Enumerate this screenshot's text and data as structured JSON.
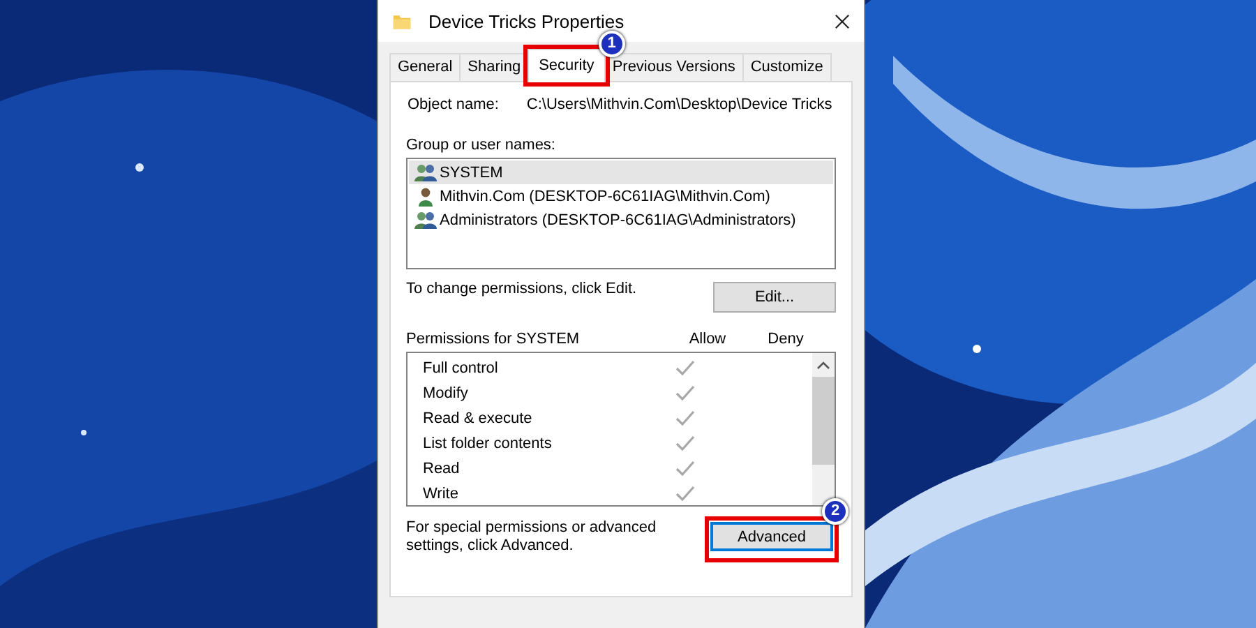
{
  "window": {
    "title": "Device Tricks Properties"
  },
  "tabs": [
    {
      "label": "General",
      "selected": false
    },
    {
      "label": "Sharing",
      "selected": false
    },
    {
      "label": "Security",
      "selected": true,
      "marker": "1"
    },
    {
      "label": "Previous Versions",
      "selected": false
    },
    {
      "label": "Customize",
      "selected": false
    }
  ],
  "object_name": {
    "label": "Object name:",
    "value": "C:\\Users\\Mithvin.Com\\Desktop\\Device Tricks"
  },
  "groups": {
    "label": "Group or user names:",
    "items": [
      {
        "name": "SYSTEM",
        "kind": "group",
        "selected": true
      },
      {
        "name": "Mithvin.Com (DESKTOP-6C61IAG\\Mithvin.Com)",
        "kind": "user",
        "selected": false
      },
      {
        "name": "Administrators (DESKTOP-6C61IAG\\Administrators)",
        "kind": "group",
        "selected": false
      }
    ]
  },
  "edit_hint": "To change permissions, click Edit.",
  "edit_button": "Edit...",
  "permissions": {
    "label": "Permissions for SYSTEM",
    "allow_label": "Allow",
    "deny_label": "Deny",
    "rows": [
      {
        "name": "Full control",
        "allow": true,
        "deny": false
      },
      {
        "name": "Modify",
        "allow": true,
        "deny": false
      },
      {
        "name": "Read & execute",
        "allow": true,
        "deny": false
      },
      {
        "name": "List folder contents",
        "allow": true,
        "deny": false
      },
      {
        "name": "Read",
        "allow": true,
        "deny": false
      },
      {
        "name": "Write",
        "allow": true,
        "deny": false
      }
    ]
  },
  "advanced_hint": "For special permissions or advanced settings, click Advanced.",
  "advanced_button": {
    "label": "Advanced",
    "marker": "2"
  }
}
